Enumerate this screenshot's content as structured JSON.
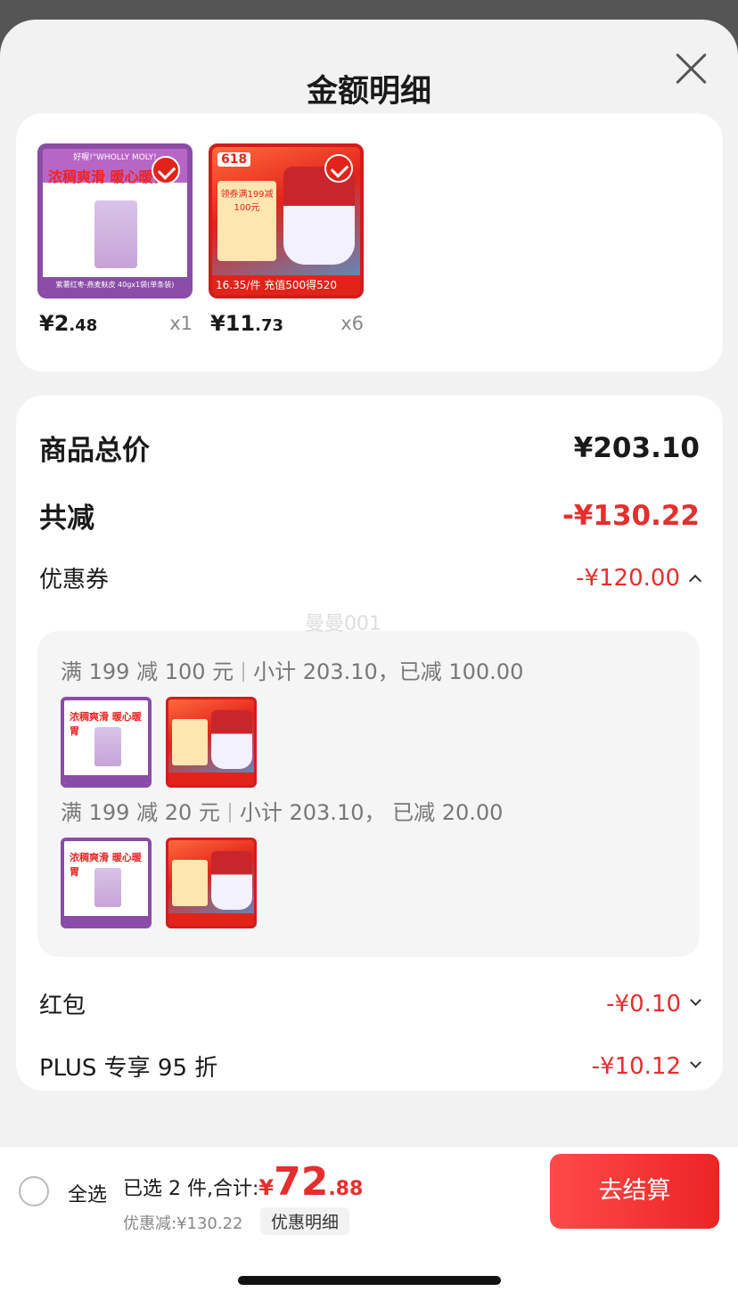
{
  "title": "金额明细",
  "items": [
    {
      "thumb_headline": "浓稠爽滑 暖心暖胃",
      "thumb_brand": "好喔!\"WHOLLY MOLY!",
      "thumb_footer": "紫薯红枣-燕麦麸皮 40gx1袋(单条装)",
      "price_int": "¥2",
      "price_dec": ".48",
      "qty": "x1"
    },
    {
      "thumb_tag": "618",
      "thumb_panel": "领券满199减 100元",
      "thumb_footer": "16.35/件 充值500得520",
      "price_int": "¥11",
      "price_dec": ".73",
      "qty": "x6"
    }
  ],
  "breakdown": {
    "total_label": "商品总价",
    "total_value": "¥203.10",
    "reduce_label": "共减",
    "reduce_value": "-¥130.22",
    "coupon_label": "优惠券",
    "coupon_value": "-¥120.00",
    "redpacket_label": "红包",
    "redpacket_value": "-¥0.10",
    "plus_label": "PLUS 专享 95 折",
    "plus_value": "-¥10.12"
  },
  "coupons": [
    {
      "rule": "满 199 减 100 元",
      "detail": "小计 203.10，已减 100.00"
    },
    {
      "rule": "满 199 减 20 元",
      "detail": "小计 203.10， 已减 20.00"
    }
  ],
  "watermark": "曼曼001",
  "bottom": {
    "select_all": "全选",
    "selected_prefix": "已选 2 件,合计:",
    "currency": "¥",
    "total_int": "72",
    "total_dec": ".88",
    "discount_text": "优惠减:¥130.22",
    "detail_button": "优惠明细",
    "checkout_button": "去结算"
  },
  "colors": {
    "accent": "#e52e2e",
    "checkout": "#ec2424"
  }
}
